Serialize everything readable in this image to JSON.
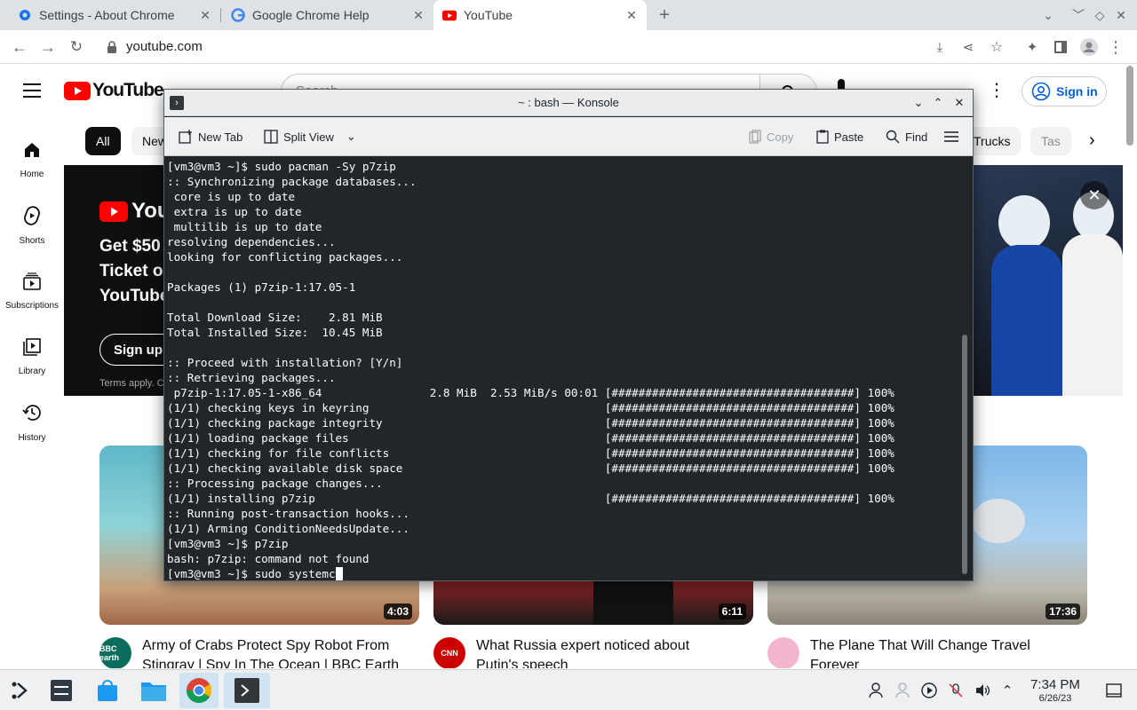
{
  "browser": {
    "tabs": [
      {
        "title": "Settings - About Chrome",
        "icon": "gear-icon"
      },
      {
        "title": "Google Chrome Help",
        "icon": "google-icon"
      },
      {
        "title": "YouTube",
        "icon": "youtube-icon"
      }
    ],
    "url": "youtube.com"
  },
  "youtube": {
    "sign_in": "Sign in",
    "logo_text": "YouTube",
    "search_placeholder": "Search",
    "sidebar": [
      {
        "label": "Home",
        "icon": "home-icon"
      },
      {
        "label": "Shorts",
        "icon": "shorts-icon"
      },
      {
        "label": "Subscriptions",
        "icon": "subscriptions-icon"
      },
      {
        "label": "Library",
        "icon": "library-icon"
      },
      {
        "label": "History",
        "icon": "history-icon"
      }
    ],
    "chips": [
      "All",
      "New",
      "Trucks",
      "Tas"
    ],
    "banner": {
      "logo": "You",
      "line1": "Get $50",
      "line2": "Ticket o",
      "line3": "YouTube",
      "button": "Sign up n",
      "terms": "Terms apply. C"
    },
    "videos": [
      {
        "title_line1": "Army of Crabs Protect Spy Robot From",
        "title_line2": "Stingray | Spy In The Ocean | BBC Earth",
        "duration": "4:03",
        "channel_badge": "BBC earth"
      },
      {
        "title_line1": "What Russia expert noticed about",
        "title_line2": "Putin's speech",
        "duration": "6:11",
        "channel_badge": "CNN"
      },
      {
        "title_line1": "The Plane That Will Change Travel",
        "title_line2": "Forever",
        "duration": "17:36",
        "channel_badge": ""
      }
    ]
  },
  "konsole": {
    "title": "~ : bash — Konsole",
    "toolbar": {
      "new_tab": "New Tab",
      "split_view": "Split View",
      "copy": "Copy",
      "paste": "Paste",
      "find": "Find"
    },
    "lines": [
      "[vm3@vm3 ~]$ sudo pacman -Sy p7zip",
      ":: Synchronizing package databases...",
      " core is up to date",
      " extra is up to date",
      " multilib is up to date",
      "resolving dependencies...",
      "looking for conflicting packages...",
      "",
      "Packages (1) p7zip-1:17.05-1",
      "",
      "Total Download Size:    2.81 MiB",
      "Total Installed Size:  10.45 MiB",
      "",
      ":: Proceed with installation? [Y/n]",
      ":: Retrieving packages...",
      " p7zip-1:17.05-1-x86_64                2.8 MiB  2.53 MiB/s 00:01 [####################################] 100%",
      "(1/1) checking keys in keyring                                   [####################################] 100%",
      "(1/1) checking package integrity                                 [####################################] 100%",
      "(1/1) loading package files                                      [####################################] 100%",
      "(1/1) checking for file conflicts                                [####################################] 100%",
      "(1/1) checking available disk space                              [####################################] 100%",
      ":: Processing package changes...",
      "(1/1) installing p7zip                                           [####################################] 100%",
      ":: Running post-transaction hooks...",
      "(1/1) Arming ConditionNeedsUpdate...",
      "[vm3@vm3 ~]$ p7zip",
      "bash: p7zip: command not found"
    ],
    "prompt_line": "[vm3@vm3 ~]$ sudo systemc"
  },
  "taskbar": {
    "time": "7:34 PM",
    "date": "6/26/23"
  },
  "colors": {
    "youtube_red": "#ff0000",
    "sign_in_blue": "#065fd4",
    "konsole_bg": "#232629",
    "chrome_tabstrip": "#dee1e6"
  }
}
